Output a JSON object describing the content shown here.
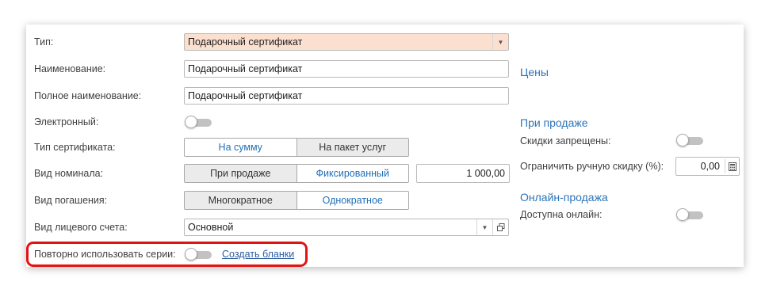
{
  "form": {
    "type": {
      "label": "Тип:",
      "value": "Подарочный сертификат"
    },
    "name": {
      "label": "Наименование:",
      "value": "Подарочный сертификат"
    },
    "full_name": {
      "label": "Полное наименование:",
      "value": "Подарочный сертификат"
    },
    "electronic": {
      "label": "Электронный:",
      "on": false
    },
    "cert_type": {
      "label": "Тип сертификата:",
      "options": [
        "На сумму",
        "На пакет услуг"
      ],
      "selected": "На сумму"
    },
    "nominal": {
      "label": "Вид номинала:",
      "options": [
        "При продаже",
        "Фиксированный"
      ],
      "selected": "Фиксированный",
      "amount": "1 000,00"
    },
    "redemption": {
      "label": "Вид погашения:",
      "options": [
        "Многократное",
        "Однократное"
      ],
      "selected": "Однократное"
    },
    "account": {
      "label": "Вид лицевого счета:",
      "value": "Основной"
    },
    "reuse_series": {
      "label": "Повторно использовать серии:",
      "on": false,
      "link": "Создать бланки"
    }
  },
  "right": {
    "prices_title": "Цены",
    "on_sale_title": "При продаже",
    "discounts_forbidden": {
      "label": "Скидки запрещены:",
      "on": false
    },
    "limit_discount": {
      "label": "Ограничить ручную скидку (%):",
      "value": "0,00"
    },
    "online_title": "Онлайн-продажа",
    "available_online": {
      "label": "Доступна онлайн:",
      "on": false
    }
  },
  "colors": {
    "accent": "#2d74b9",
    "highlight": "#e21313",
    "type_field_bg": "#fce0cf"
  }
}
